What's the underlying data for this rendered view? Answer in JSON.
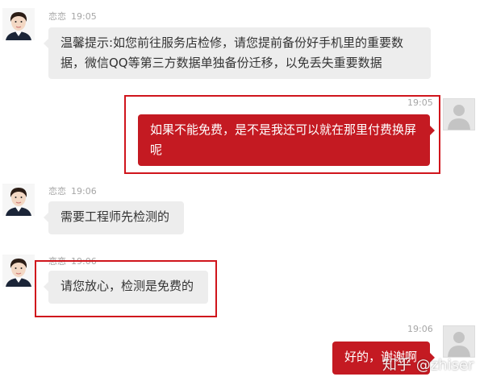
{
  "colors": {
    "outgoing_bubble": "#c41a22",
    "incoming_bubble": "#ededed",
    "highlight_box": "#d0151c",
    "meta_text": "#a6a6a6"
  },
  "messages": [
    {
      "sender": "agent",
      "name": "恋恋",
      "time": "19:05",
      "text": "温馨提示:如您前往服务店检修，请您提前备份好手机里的重要数据，微信QQ等第三方数据单独备份迁移，以免丢失重要数据"
    },
    {
      "sender": "user",
      "time": "19:05",
      "text": "如果不能免费，是不是我还可以就在那里付费换屏呢",
      "highlighted": true
    },
    {
      "sender": "agent",
      "name": "恋恋",
      "time": "19:06",
      "text": "需要工程师先检测的"
    },
    {
      "sender": "agent",
      "name": "恋恋",
      "time": "19:06",
      "text": "请您放心，检测是免费的",
      "highlighted": true
    },
    {
      "sender": "user",
      "time": "19:06",
      "text": "好的，谢谢啊"
    }
  ],
  "watermark": "知乎 @zhiser"
}
